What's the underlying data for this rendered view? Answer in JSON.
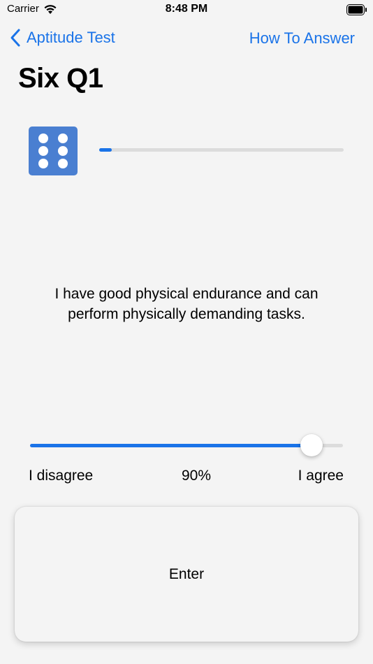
{
  "status_bar": {
    "carrier": "Carrier",
    "time": "8:48 PM",
    "wifi_icon": "wifi-icon",
    "battery_icon": "battery-icon"
  },
  "nav": {
    "back_label": "Aptitude Test",
    "back_icon": "chevron-left-icon",
    "help_label": "How To Answer"
  },
  "title": "Six Q1",
  "dice": {
    "icon": "dice-six-icon",
    "pips": 6,
    "color": "#4a7fd1"
  },
  "progress": {
    "fraction": 0.05
  },
  "question": "I have good physical endurance and can perform physically demanding tasks.",
  "slider": {
    "value": 0.9,
    "value_label": "90%",
    "min_label": "I disagree",
    "max_label": "I agree"
  },
  "enter_label": "Enter",
  "colors": {
    "accent": "#1a73e8",
    "track": "#dcdcdc",
    "background": "#f4f4f4"
  }
}
